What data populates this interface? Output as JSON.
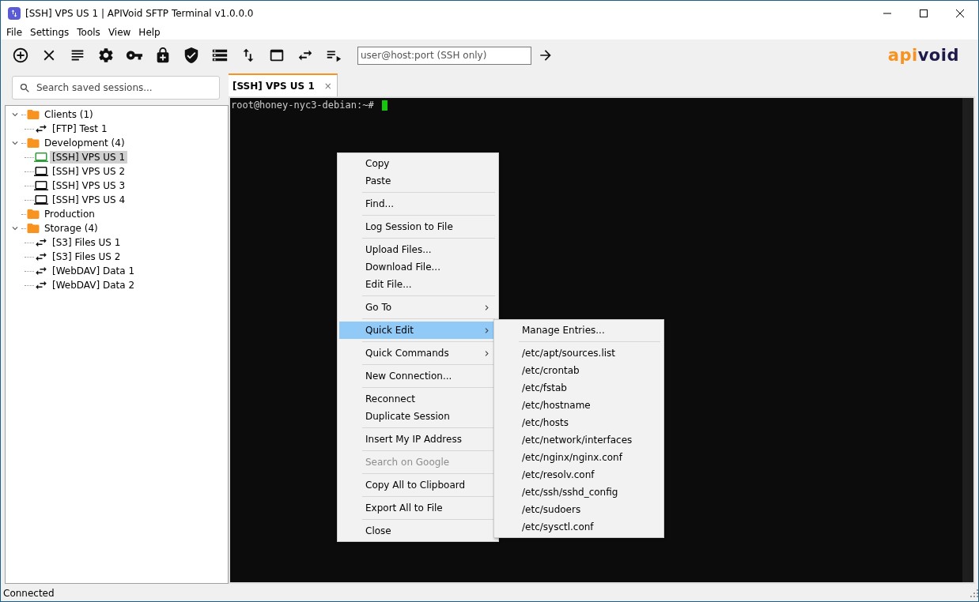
{
  "window": {
    "title": "[SSH] VPS US 1 | APIVoid SFTP Terminal v1.0.0.0"
  },
  "menu_bar": [
    "File",
    "Settings",
    "Tools",
    "View",
    "Help"
  ],
  "toolbar": {
    "address_field": {
      "placeholder": "user@host:port (SSH only)"
    },
    "logo": [
      {
        "text": "api",
        "color": "#f7931e"
      },
      {
        "text": "void",
        "color": "#1e1b4b"
      }
    ]
  },
  "sidebar": {
    "search": {
      "placeholder": "Search saved sessions..."
    },
    "tree": [
      {
        "label": "Clients (1)",
        "kind": "folder",
        "expanded": true,
        "selected": false,
        "children": [
          {
            "label": "[FTP] Test 1",
            "kind": "transfer",
            "selected": false
          }
        ]
      },
      {
        "label": "Development (4)",
        "kind": "folder",
        "expanded": true,
        "selected": false,
        "children": [
          {
            "label": "[SSH] VPS US 1",
            "kind": "ssh",
            "selected": true,
            "connected": true
          },
          {
            "label": "[SSH] VPS US 2",
            "kind": "ssh",
            "selected": false,
            "connected": false
          },
          {
            "label": "[SSH] VPS US 3",
            "kind": "ssh",
            "selected": false,
            "connected": false
          },
          {
            "label": "[SSH] VPS US 4",
            "kind": "ssh",
            "selected": false,
            "connected": false
          }
        ]
      },
      {
        "label": "Production",
        "kind": "folder",
        "selected": false
      },
      {
        "label": "Storage (4)",
        "kind": "folder",
        "expanded": true,
        "selected": false,
        "children": [
          {
            "label": "[S3] Files US 1",
            "kind": "transfer",
            "selected": false
          },
          {
            "label": "[S3] Files US 2",
            "kind": "transfer",
            "selected": false
          },
          {
            "label": "[WebDAV] Data 1",
            "kind": "transfer",
            "selected": false
          },
          {
            "label": "[WebDAV] Data 2",
            "kind": "transfer",
            "selected": false
          }
        ]
      }
    ]
  },
  "tabs": [
    {
      "label": "[SSH] VPS US 1",
      "selected": true,
      "close": "×"
    }
  ],
  "terminal": {
    "prompt": "root@honey-nyc3-debian:~#"
  },
  "context_menu": {
    "groups": [
      [
        {
          "label": "Copy",
          "submenu": false,
          "selected": false,
          "disabled": false
        },
        {
          "label": "Paste",
          "submenu": false,
          "selected": false,
          "disabled": false
        }
      ],
      [
        {
          "label": "Find...",
          "submenu": false,
          "selected": false,
          "disabled": false
        }
      ],
      [
        {
          "label": "Log Session to File",
          "submenu": false,
          "selected": false,
          "disabled": false
        }
      ],
      [
        {
          "label": "Upload Files...",
          "submenu": false,
          "selected": false,
          "disabled": false
        },
        {
          "label": "Download File...",
          "submenu": false,
          "selected": false,
          "disabled": false
        },
        {
          "label": "Edit File...",
          "submenu": false,
          "selected": false,
          "disabled": false
        }
      ],
      [
        {
          "label": "Go To",
          "submenu": true,
          "selected": false,
          "disabled": false
        }
      ],
      [
        {
          "label": "Quick Edit",
          "submenu": true,
          "selected": true,
          "disabled": false
        }
      ],
      [
        {
          "label": "Quick Commands",
          "submenu": true,
          "selected": false,
          "disabled": false
        }
      ],
      [
        {
          "label": "New Connection...",
          "submenu": false,
          "selected": false,
          "disabled": false
        }
      ],
      [
        {
          "label": "Reconnect",
          "submenu": false,
          "selected": false,
          "disabled": false
        },
        {
          "label": "Duplicate Session",
          "submenu": false,
          "selected": false,
          "disabled": false
        }
      ],
      [
        {
          "label": "Insert My IP Address",
          "submenu": false,
          "selected": false,
          "disabled": false
        }
      ],
      [
        {
          "label": "Search on Google",
          "submenu": false,
          "selected": false,
          "disabled": true
        }
      ],
      [
        {
          "label": "Copy All to Clipboard",
          "submenu": false,
          "selected": false,
          "disabled": false
        }
      ],
      [
        {
          "label": "Export All to File",
          "submenu": false,
          "selected": false,
          "disabled": false
        }
      ],
      [
        {
          "label": "Close",
          "submenu": false,
          "selected": false,
          "disabled": false
        }
      ]
    ]
  },
  "submenu": {
    "groups": [
      [
        {
          "label": "Manage Entries...",
          "submenu": false,
          "selected": false,
          "disabled": false
        }
      ],
      [
        {
          "label": "/etc/apt/sources.list",
          "submenu": false,
          "selected": false,
          "disabled": false
        },
        {
          "label": "/etc/crontab",
          "submenu": false,
          "selected": false,
          "disabled": false
        },
        {
          "label": "/etc/fstab",
          "submenu": false,
          "selected": false,
          "disabled": false
        },
        {
          "label": "/etc/hostname",
          "submenu": false,
          "selected": false,
          "disabled": false
        },
        {
          "label": "/etc/hosts",
          "submenu": false,
          "selected": false,
          "disabled": false
        },
        {
          "label": "/etc/network/interfaces",
          "submenu": false,
          "selected": false,
          "disabled": false
        },
        {
          "label": "/etc/nginx/nginx.conf",
          "submenu": false,
          "selected": false,
          "disabled": false
        },
        {
          "label": "/etc/resolv.conf",
          "submenu": false,
          "selected": false,
          "disabled": false
        },
        {
          "label": "/etc/ssh/sshd_config",
          "submenu": false,
          "selected": false,
          "disabled": false
        },
        {
          "label": "/etc/sudoers",
          "submenu": false,
          "selected": false,
          "disabled": false
        },
        {
          "label": "/etc/sysctl.conf",
          "submenu": false,
          "selected": false,
          "disabled": false
        }
      ]
    ]
  },
  "status_bar": {
    "text": "Connected"
  }
}
